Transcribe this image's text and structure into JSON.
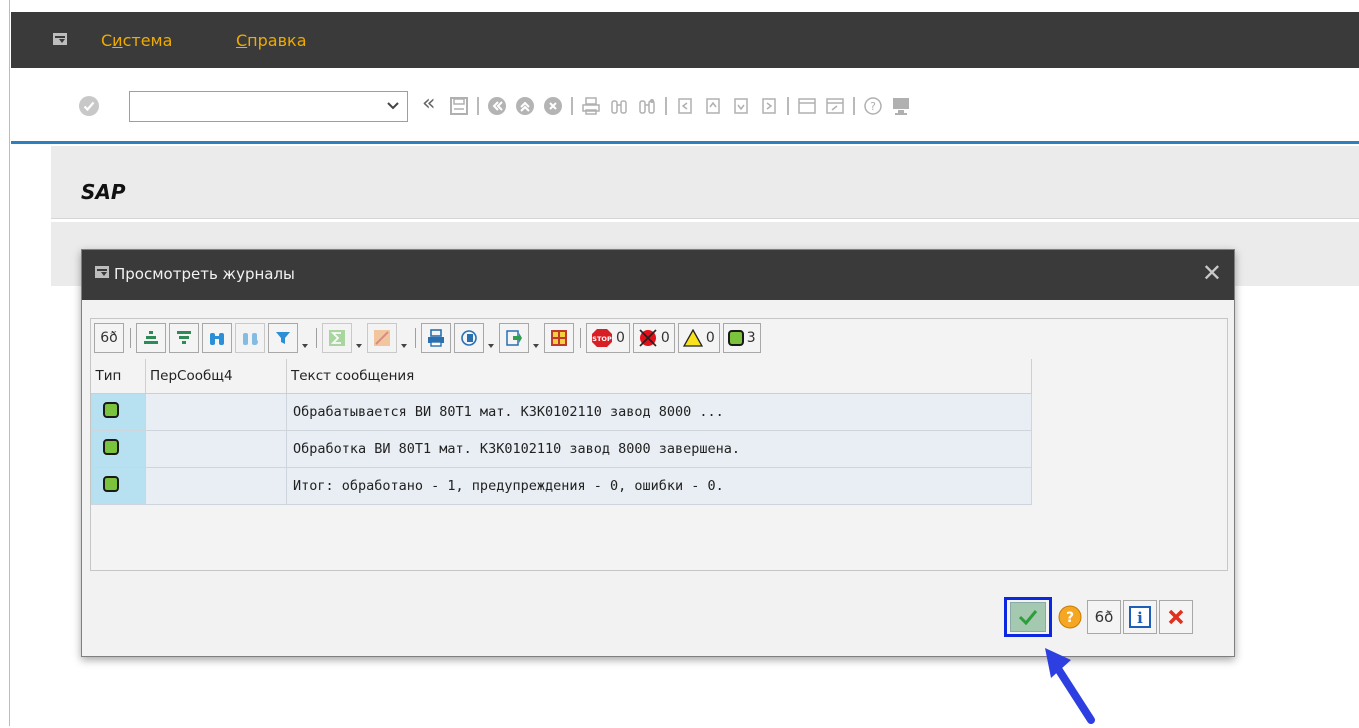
{
  "menu": {
    "items": [
      {
        "prefix": "С",
        "underlined": "и",
        "suffix": "стема"
      },
      {
        "prefix": "",
        "underlined": "С",
        "suffix": "правка"
      }
    ]
  },
  "toolbar": {
    "command_field_value": "",
    "collapse_label": "«",
    "icons": [
      "enter-icon",
      "command-field",
      "save-icon",
      "back-icon",
      "exit-icon",
      "cancel-icon",
      "print-icon",
      "find-icon",
      "find-next-icon",
      "first-page-icon",
      "previous-page-icon",
      "next-page-icon",
      "last-page-icon",
      "new-session-icon",
      "shortcut-icon",
      "help-icon",
      "customize-icon"
    ]
  },
  "title": {
    "text": "SAP"
  },
  "dialog": {
    "title": "Просмотреть журналы",
    "close_glyph": "✕",
    "alv_toolbar": {
      "counts": {
        "stop": "0",
        "error": "0",
        "warning": "0",
        "success": "3"
      }
    },
    "grid": {
      "columns": [
        "Тип",
        "ПерСообщ4",
        "Текст сообщения"
      ],
      "rows": [
        {
          "type": "green-lamp",
          "per": "",
          "text": "Обрабатывается ВИ 80Т1 мат. К3К0102110 завод 8000 ..."
        },
        {
          "type": "green-lamp",
          "per": "",
          "text": "Обработка ВИ 80Т1 мат. К3К0102110 завод 8000 завершена."
        },
        {
          "type": "green-lamp",
          "per": "",
          "text": "Итог: обработано - 1, предупреждения - 0, ошибки - 0."
        }
      ]
    },
    "buttons": [
      "continue-button",
      "help-button",
      "details-button",
      "info-button",
      "cancel-button"
    ]
  },
  "colors": {
    "menubar_bg": "#3a3a3a",
    "menu_text": "#f0ab00",
    "accent_line": "#2f7fc0",
    "focus_border": "#0b27e0",
    "lamp_green": "#7bc33c",
    "arrow": "#2d3fe0"
  }
}
